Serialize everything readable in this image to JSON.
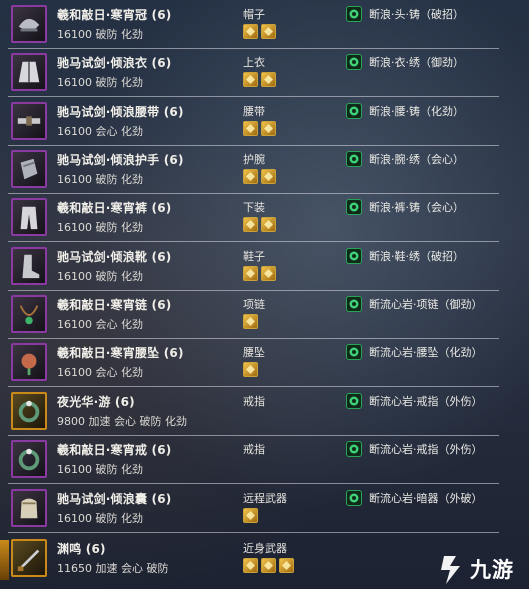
{
  "equipment": [
    {
      "name": "羲和敲日·寒宵冠 (6)",
      "stats": "16100 破防 化劲",
      "slot": "帽子",
      "gems": 2,
      "enhance": "断浪·头·铸（破招）",
      "icon": "helmet-icon",
      "frame": "purple"
    },
    {
      "name": "驰马试剑·倾浪衣 (6)",
      "stats": "16100 破防 化劲",
      "slot": "上衣",
      "gems": 2,
      "enhance": "断浪·衣·绣（御劲）",
      "icon": "robe-icon",
      "frame": "purple"
    },
    {
      "name": "驰马试剑·倾浪腰带 (6)",
      "stats": "16100 会心 化劲",
      "slot": "腰带",
      "gems": 2,
      "enhance": "断浪·腰·铸（化劲）",
      "icon": "belt-icon",
      "frame": "purple"
    },
    {
      "name": "驰马试剑·倾浪护手 (6)",
      "stats": "16100 破防 化劲",
      "slot": "护腕",
      "gems": 2,
      "enhance": "断浪·腕·绣（会心）",
      "icon": "bracer-icon",
      "frame": "purple"
    },
    {
      "name": "羲和敲日·寒宵裤 (6)",
      "stats": "16100 破防 化劲",
      "slot": "下装",
      "gems": 2,
      "enhance": "断浪·裤·铸（会心）",
      "icon": "pants-icon",
      "frame": "purple"
    },
    {
      "name": "驰马试剑·倾浪靴 (6)",
      "stats": "16100 破防 化劲",
      "slot": "鞋子",
      "gems": 2,
      "enhance": "断浪·鞋·绣（破招）",
      "icon": "boots-icon",
      "frame": "purple"
    },
    {
      "name": "羲和敲日·寒宵链 (6)",
      "stats": "16100 会心 化劲",
      "slot": "项链",
      "gems": 1,
      "enhance": "断流心岩·项链（御劲）",
      "icon": "necklace-icon",
      "frame": "purple"
    },
    {
      "name": "羲和敲日·寒宵腰坠 (6)",
      "stats": "16100 会心 化劲",
      "slot": "腰坠",
      "gems": 1,
      "enhance": "断流心岩·腰坠（化劲）",
      "icon": "pendant-icon",
      "frame": "purple"
    },
    {
      "name": "夜光华·游 (6)",
      "stats": "9800 加速 会心 破防 化劲",
      "slot": "戒指",
      "gems": 0,
      "enhance": "断流心岩·戒指（外伤）",
      "icon": "ring-icon",
      "frame": "orange"
    },
    {
      "name": "羲和敲日·寒宵戒 (6)",
      "stats": "16100 破防 化劲",
      "slot": "戒指",
      "gems": 0,
      "enhance": "断流心岩·戒指（外伤）",
      "icon": "ring-icon",
      "frame": "purple"
    },
    {
      "name": "驰马试剑·倾浪囊 (6)",
      "stats": "16100 破防 化劲",
      "slot": "远程武器",
      "gems": 1,
      "enhance": "断流心岩·暗器（外破）",
      "icon": "pouch-icon",
      "frame": "purple"
    },
    {
      "name": "渊鸣 (6)",
      "stats": "11650 加速 会心 破防",
      "slot": "近身武器",
      "gems": 3,
      "enhance": "",
      "icon": "blade-icon",
      "frame": "orange"
    }
  ],
  "watermark": {
    "text": "九游",
    "icon": "jiuyou-logo-icon"
  },
  "colors": {
    "purple_frame": "#8a3aa0",
    "orange_frame": "#c98a1a",
    "gem_gold": "#e8b43a",
    "enhance_green": "#2aa55a"
  }
}
